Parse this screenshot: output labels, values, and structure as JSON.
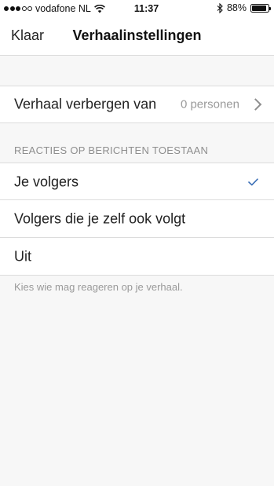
{
  "status_bar": {
    "carrier": "vodafone NL",
    "time": "11:37",
    "battery_percent": "88%",
    "battery_level": 0.88,
    "signal_bars_filled": 3,
    "signal_bars_total": 5,
    "icons": [
      "signal-dots-icon",
      "wifi-icon",
      "bluetooth-icon",
      "battery-icon"
    ]
  },
  "nav": {
    "back_label": "Klaar",
    "title": "Verhaalinstellingen"
  },
  "hide_story": {
    "label": "Verhaal verbergen van",
    "value": "0 personen"
  },
  "replies_section": {
    "header": "REACTIES OP BERICHTEN TOESTAAN",
    "options": [
      {
        "label": "Je volgers",
        "selected": true
      },
      {
        "label": "Volgers die je zelf ook volgt",
        "selected": false
      },
      {
        "label": "Uit",
        "selected": false
      }
    ],
    "footer": "Kies wie mag reageren op je verhaal."
  },
  "colors": {
    "background": "#f7f7f7",
    "row_background": "#ffffff",
    "separator": "#dcdcdc",
    "secondary_text": "#9a9a9a",
    "checkmark": "#3b6fb6"
  }
}
